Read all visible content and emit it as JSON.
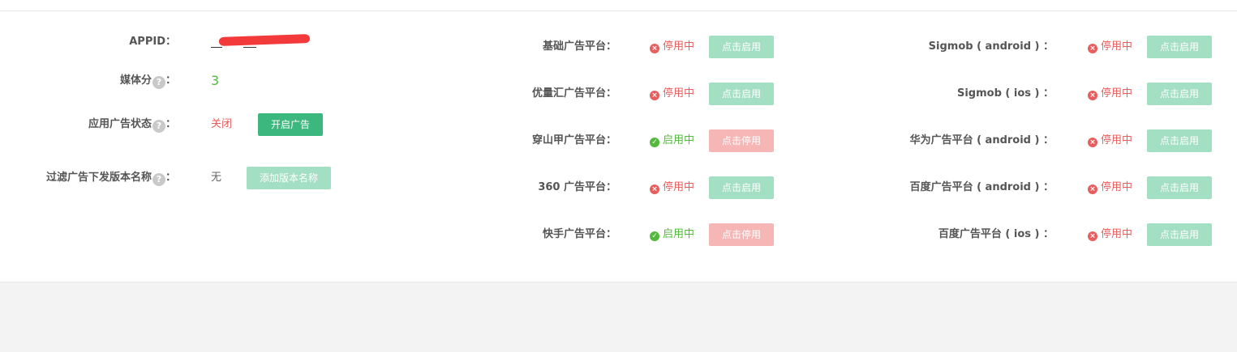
{
  "left": {
    "appid_label": "APPID：",
    "media_score_label": "媒体分",
    "media_score_colon": "：",
    "media_score_value": "3",
    "ad_status_label": "应用广告状态",
    "ad_status_colon": "：",
    "ad_status_value": "关闭",
    "ad_status_button": "开启广告",
    "filter_label": "过滤广告下发版本名称",
    "filter_colon": "：",
    "filter_value": "无",
    "filter_button": "添加版本名称",
    "help_glyph": "?"
  },
  "platforms_middle": [
    {
      "label": "基础广告平台：",
      "status": "停用中",
      "action": "点击启用"
    },
    {
      "label": "优量汇广告平台：",
      "status": "停用中",
      "action": "点击启用"
    },
    {
      "label": "穿山甲广告平台：",
      "status": "启用中",
      "action": "点击停用"
    },
    {
      "label": "360 广告平台：",
      "status": "停用中",
      "action": "点击启用"
    },
    {
      "label": "快手广告平台：",
      "status": "启用中",
      "action": "点击停用"
    }
  ],
  "platforms_right": [
    {
      "label": "Sigmob ( android ) ：",
      "status": "停用中",
      "action": "点击启用"
    },
    {
      "label": "Sigmob ( ios ) ：",
      "status": "停用中",
      "action": "点击启用"
    },
    {
      "label": "华为广告平台 ( android ) ：",
      "status": "停用中",
      "action": "点击启用"
    },
    {
      "label": "百度广告平台 ( android ) ：",
      "status": "停用中",
      "action": "点击启用"
    },
    {
      "label": "百度广告平台 ( ios ) ：",
      "status": "停用中",
      "action": "点击启用"
    }
  ],
  "icons": {
    "off": "x-circle-icon",
    "on": "check-circle-icon",
    "off_glyph": "×",
    "on_glyph": "✓"
  },
  "colors": {
    "enabled": "#52b93a",
    "disabled": "#e85d5d",
    "primary_button": "#3cb87f",
    "enable_button": "#a3dfc3",
    "disable_button": "#f6b6b6"
  }
}
